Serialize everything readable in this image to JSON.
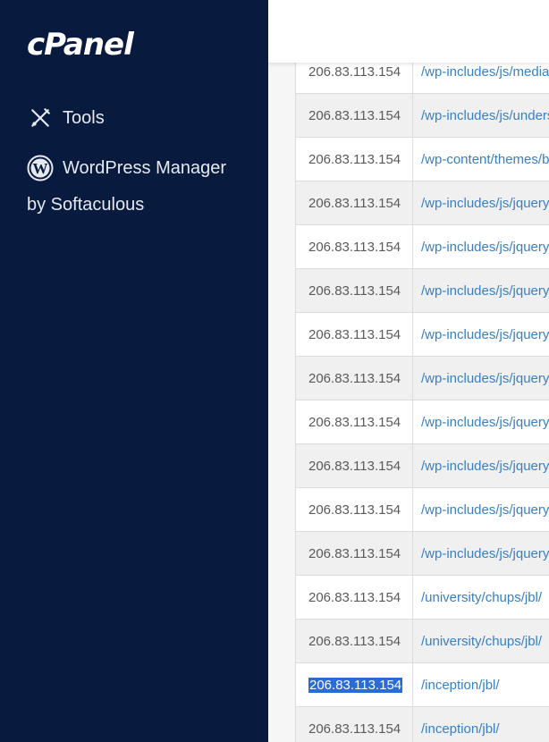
{
  "sidebar": {
    "logo": "cPanel",
    "items": [
      {
        "label": "Tools",
        "icon": "tools-icon"
      },
      {
        "label_line1": "WordPress Manager",
        "label_line2": "by Softaculous",
        "icon": "wordpress-icon"
      }
    ]
  },
  "table": {
    "rows": [
      {
        "ip": "206.83.113.154",
        "path": "/wp-includes/js/media"
      },
      {
        "ip": "206.83.113.154",
        "path": "/wp-includes/js/unders"
      },
      {
        "ip": "206.83.113.154",
        "path": "/wp-content/themes/b"
      },
      {
        "ip": "206.83.113.154",
        "path": "/wp-includes/js/jquery"
      },
      {
        "ip": "206.83.113.154",
        "path": "/wp-includes/js/jquery"
      },
      {
        "ip": "206.83.113.154",
        "path": "/wp-includes/js/jquery"
      },
      {
        "ip": "206.83.113.154",
        "path": "/wp-includes/js/jquery"
      },
      {
        "ip": "206.83.113.154",
        "path": "/wp-includes/js/jquery"
      },
      {
        "ip": "206.83.113.154",
        "path": "/wp-includes/js/jquery"
      },
      {
        "ip": "206.83.113.154",
        "path": "/wp-includes/js/jquery"
      },
      {
        "ip": "206.83.113.154",
        "path": "/wp-includes/js/jquery"
      },
      {
        "ip": "206.83.113.154",
        "path": "/wp-includes/js/jquery"
      },
      {
        "ip": "206.83.113.154",
        "path": "/university/chups/jbl/"
      },
      {
        "ip": "206.83.113.154",
        "path": "/university/chups/jbl/"
      },
      {
        "ip": "206.83.113.154",
        "path": "/inception/jbl/",
        "selected": true
      },
      {
        "ip": "206.83.113.154",
        "path": "/inception/jbl/"
      }
    ]
  },
  "colors": {
    "sidebar_bg": "#081a3e",
    "link": "#3a7fc1",
    "selection": "#2a6bd6"
  }
}
